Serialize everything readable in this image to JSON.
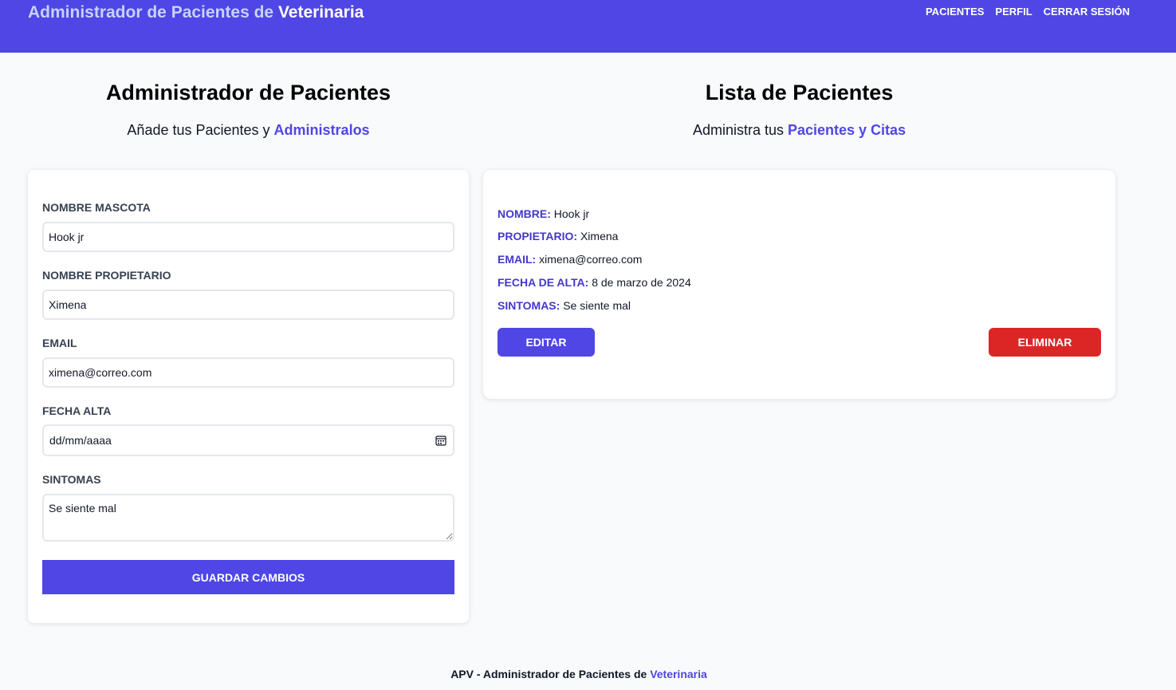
{
  "header": {
    "brand_prefix": "Administrador de Pacientes de ",
    "brand_strong": "Veterinaria",
    "nav": [
      "Pacientes",
      "Perfil",
      "Cerrar Sesión"
    ]
  },
  "left": {
    "title": "Administrador de Pacientes",
    "subtitle_prefix": "Añade tus Pacientes y ",
    "subtitle_accent": "Administralos"
  },
  "right": {
    "title": "Lista de Pacientes",
    "subtitle_prefix": "Administra tus ",
    "subtitle_accent": "Pacientes y Citas"
  },
  "form": {
    "pet_label": "Nombre Mascota",
    "pet_value": "Hook jr",
    "owner_label": "Nombre Propietario",
    "owner_value": "Ximena",
    "email_label": "Email",
    "email_value": "ximena@correo.com",
    "date_label": "Fecha Alta",
    "date_value": "dd/mm/aaaa",
    "symptoms_label": "Sintomas",
    "symptoms_value": "Se siente mal",
    "submit_label": "Guardar Cambios"
  },
  "patient": {
    "name_key": "Nombre:",
    "name_value": "Hook jr",
    "owner_key": "Propietario:",
    "owner_value": "Ximena",
    "email_key": "Email:",
    "email_value": "ximena@correo.com",
    "date_key": "Fecha de Alta:",
    "date_value": "8 de marzo de 2024",
    "symptoms_key": "Sintomas:",
    "symptoms_value": "Se siente mal",
    "edit_label": "Editar",
    "delete_label": "Eliminar"
  },
  "footer": {
    "prefix": "APV - Administrador de Pacientes de ",
    "accent": "Veterinaria"
  },
  "colors": {
    "primary": "#4f46e5",
    "danger": "#dc2626",
    "label_accent": "#4338ca",
    "background": "#f9fafb"
  },
  "icons": {
    "date_field": "calendar-icon"
  }
}
